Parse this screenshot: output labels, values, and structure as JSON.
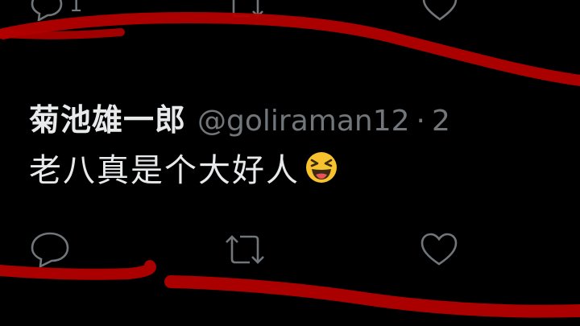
{
  "top_actions": {
    "reply_count": "1"
  },
  "tweet": {
    "display_name": "菊池雄一郎",
    "handle": "@goliraman12",
    "separator": "·",
    "time_partial": "2",
    "text": "老八真是个大好人",
    "emoji": "laughing-face-emoji"
  },
  "colors": {
    "background": "#000000",
    "text": "#e7e9ea",
    "muted": "#71767b",
    "marker": "#b30000"
  },
  "icons": [
    "reply-icon",
    "retweet-icon",
    "like-icon"
  ]
}
